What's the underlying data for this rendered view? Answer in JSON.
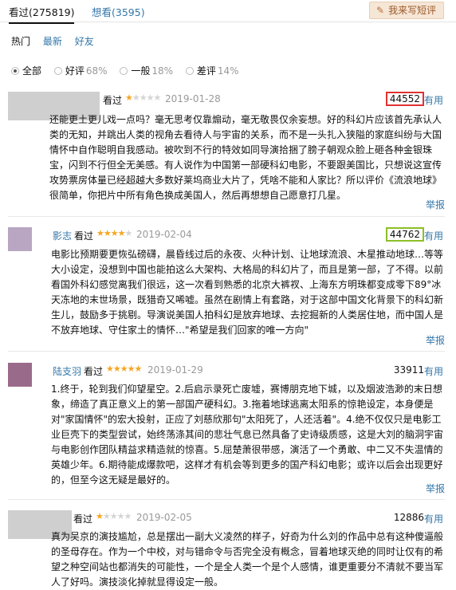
{
  "tabs": {
    "watched": "看过(275819)",
    "want": "想看(3595)"
  },
  "write_button": {
    "icon": "pen-icon",
    "label": "我来写短评"
  },
  "subnav": {
    "hot": "热门",
    "latest": "最新",
    "friends": "好友"
  },
  "filter": {
    "all": "全部",
    "good": "好评",
    "good_pct": "68%",
    "mid": "一般",
    "mid_pct": "18%",
    "bad": "差评",
    "bad_pct": "14%"
  },
  "colors": {
    "link": "#3377aa",
    "star": "#f5a623",
    "highlight_red": "#e23131",
    "highlight_green": "#8cbf26"
  },
  "reviews": [
    {
      "user": "",
      "status": "看过",
      "rating_stars": 1,
      "date": "2019-01-28",
      "votes": "44552",
      "useful": "有用",
      "report": "举报",
      "text": "还能更土更儿戏一点吗？毫无思考仅靠煽动，毫无敬畏仅余妄想。好的科幻片应该首先承认人类的无知，并跳出人类的视角去看待人与宇宙的关系，而不是一头扎入狭隘的家庭纠纷与大国情怀中自作聪明自我感动。被吹到不行的特效如同导演拾捆了膀子朝观众脸上砸各种金银珠宝，闪到不行但全无美感。有人说作为中国第一部硬科幻电影，不要跟美国比，只想说这宣传攻势票房体量已经超越大多数好莱坞商业大片了，凭啥不能和人家比？所以评价《流浪地球》很简单，你把片中所有角色换成美国人，然后再想想自己愿意打几星。"
    },
    {
      "user": "影志",
      "status": "看过",
      "rating_stars": 4,
      "date": "2019-02-04",
      "votes": "44762",
      "useful": "有用",
      "report": "举报",
      "text": "电影比预期要更恢弘磅礴，晨昏线过后的永夜、火种计划、让地球流浪、木星推动地球…等等大小设定，没想到中国也能拍这么大架构、大格局的科幻片了，而且是第一部，了不得。以前看国外科幻感觉离我们很远，这一次看到熟悉的北京大裤衩、上海东方明珠都变成零下89°冰天冻地的末世场景，既猎奇又唏嘘。虽然在剧情上有套路，对于这部中国文化背景下的科幻新生儿，鼓励多于挑剔。导演说美国人拍科幻是放弃地球、去挖掘新的人类居住地，而中国人是不放弃地球、守住家土的情怀…\"希望是我们回家的唯一方向\""
    },
    {
      "user": "陆支羽",
      "status": "看过",
      "rating_stars": 5,
      "date": "2019-01-29",
      "votes": "33911",
      "useful": "有用",
      "report": "举报",
      "text": "1.终于，轮到我们仰望星空。2.后启示录死亡废墟，赛博朋克地下城，以及烟波浩渺的末日想象，缔造了真正意义上的第一部国产硬科幻。3.拖着地球逃离太阳系的惊艳设定，本身便是对\"家国情怀\"的宏大投射，正应了刘慈欣那句\"太阳死了，人还活着\"。4.绝不仅仅只是电影工业巨壳下的类型尝试，始终荡涤其间的悲壮气息已然具备了史诗级质感，这是大刘的脑洞宇宙与电影创作团队精益求精造就的惊喜。5.屈楚萧很带感，演活了一个勇敢、中二又不失温情的英雄少年。6.期待能成爆款吧，这样才有机会等到更多的国产科幻电影；或许以后会出现更好的，但至今这无疑是最好的。"
    },
    {
      "user": "",
      "status": "看过",
      "rating_stars": 1,
      "date": "2019-02-05",
      "votes": "12886",
      "useful": "有用",
      "report": "",
      "text": "真为吴京的演技尴尬，总是摆出一副大义凌然的样子，好奇为什么刘的作品中总有这种傻逼般的圣母存在。作为一个中校，对与错命令与否完全没有概念，冒着地球灭绝的同时让仅有的希望之种空间站也都消失的可能性，一个是全人类一个是个人感情，谁更重要分不清就不要当军人了好吗。演技淡化掉就显得设定一般。"
    }
  ]
}
